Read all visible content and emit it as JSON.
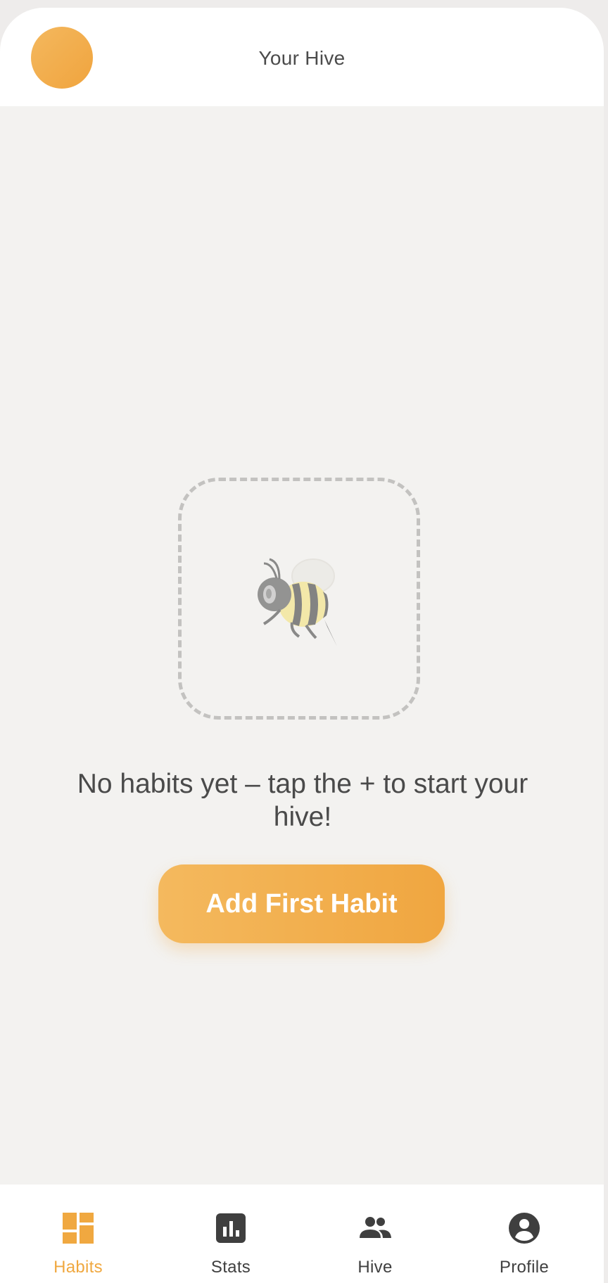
{
  "header": {
    "title": "Your Hive",
    "avatar_color": "#f2ad4c"
  },
  "empty_state": {
    "icon": "bee-icon",
    "message": "No habits yet – tap the + to start your hive!",
    "button_label": "Add First Habit"
  },
  "bottom_nav": {
    "active": "Habits",
    "accent_color": "#f0a840",
    "items": [
      {
        "label": "Habits",
        "icon": "dashboard-icon"
      },
      {
        "label": "Stats",
        "icon": "bar-chart-icon"
      },
      {
        "label": "Hive",
        "icon": "group-icon"
      },
      {
        "label": "Profile",
        "icon": "account-circle-icon"
      }
    ]
  }
}
